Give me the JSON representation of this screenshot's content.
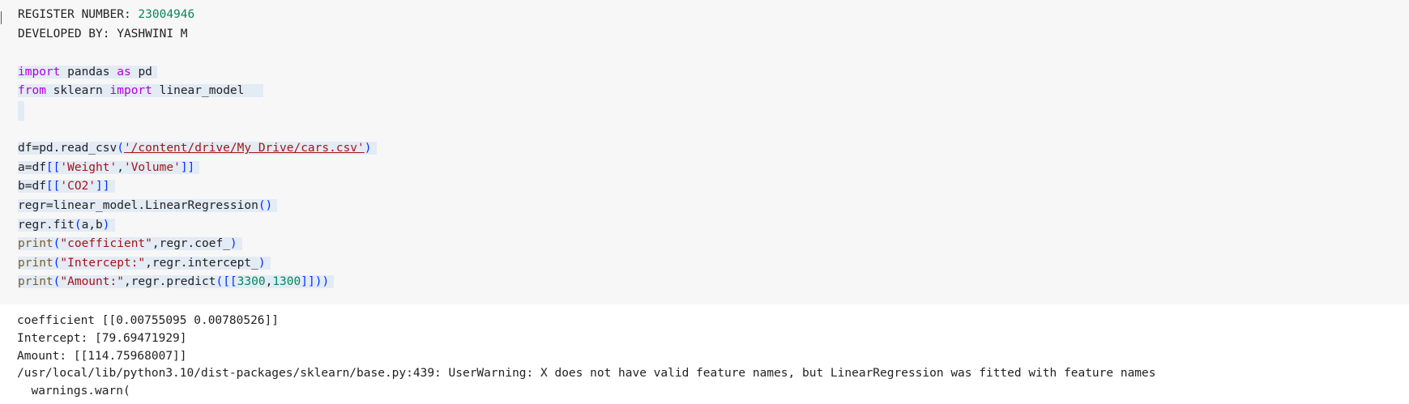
{
  "cell": {
    "register_label": "REGISTER NUMBER: ",
    "register_number": "23004946",
    "developed_by": "DEVELOPED BY: YASHWINI M",
    "line_import_pandas": {
      "kw_import": "import",
      "module": "pandas",
      "kw_as": "as",
      "alias": "pd"
    },
    "line_from_sklearn": {
      "kw_from": "from",
      "module": "sklearn",
      "kw_import": "import",
      "name": "linear_model"
    },
    "line_read_csv": {
      "prefix": "df=pd.read_csv",
      "open": "(",
      "path": "'/content/drive/My Drive/cars.csv'",
      "close": ")"
    },
    "line_a": {
      "prefix": "a=df",
      "open": "[[",
      "s1": "'Weight'",
      "comma": ",",
      "s2": "'Volume'",
      "close": "]]"
    },
    "line_b": {
      "prefix": "b=df",
      "open": "[[",
      "s1": "'CO2'",
      "close": "]]"
    },
    "line_regr": {
      "prefix": "regr=linear_model.LinearRegression",
      "parens": "()"
    },
    "line_fit": {
      "prefix": "regr.fit",
      "open": "(",
      "args": "a,b",
      "close": ")"
    },
    "line_print_coef": {
      "fn": "print",
      "open": "(",
      "str": "\"coefficient\"",
      "rest": ",regr.coef_",
      "close": ")"
    },
    "line_print_intercept": {
      "fn": "print",
      "open": "(",
      "str": "\"Intercept:\"",
      "rest": ",regr.intercept_",
      "close": ")"
    },
    "line_print_amount": {
      "fn": "print",
      "open": "(",
      "str": "\"Amount:\"",
      "mid": ",regr.predict",
      "open2": "(",
      "open3": "[[",
      "n1": "3300",
      "comma": ",",
      "n2": "1300",
      "close3": "]]",
      "close2": ")",
      "close": ")"
    }
  },
  "output": {
    "lines": [
      "coefficient [[0.00755095 0.00780526]]",
      "Intercept: [79.69471929]",
      "Amount: [[114.75968007]]",
      "/usr/local/lib/python3.10/dist-packages/sklearn/base.py:439: UserWarning: X does not have valid feature names, but LinearRegression was fitted with feature names",
      "  warnings.warn("
    ]
  },
  "colors": {
    "keyword": "#af00db",
    "function": "#795e26",
    "string": "#a31515",
    "number": "#098658",
    "bracket": "#0431fa",
    "selection": "#e3ebf5",
    "cell_background": "#f7f7f7"
  }
}
